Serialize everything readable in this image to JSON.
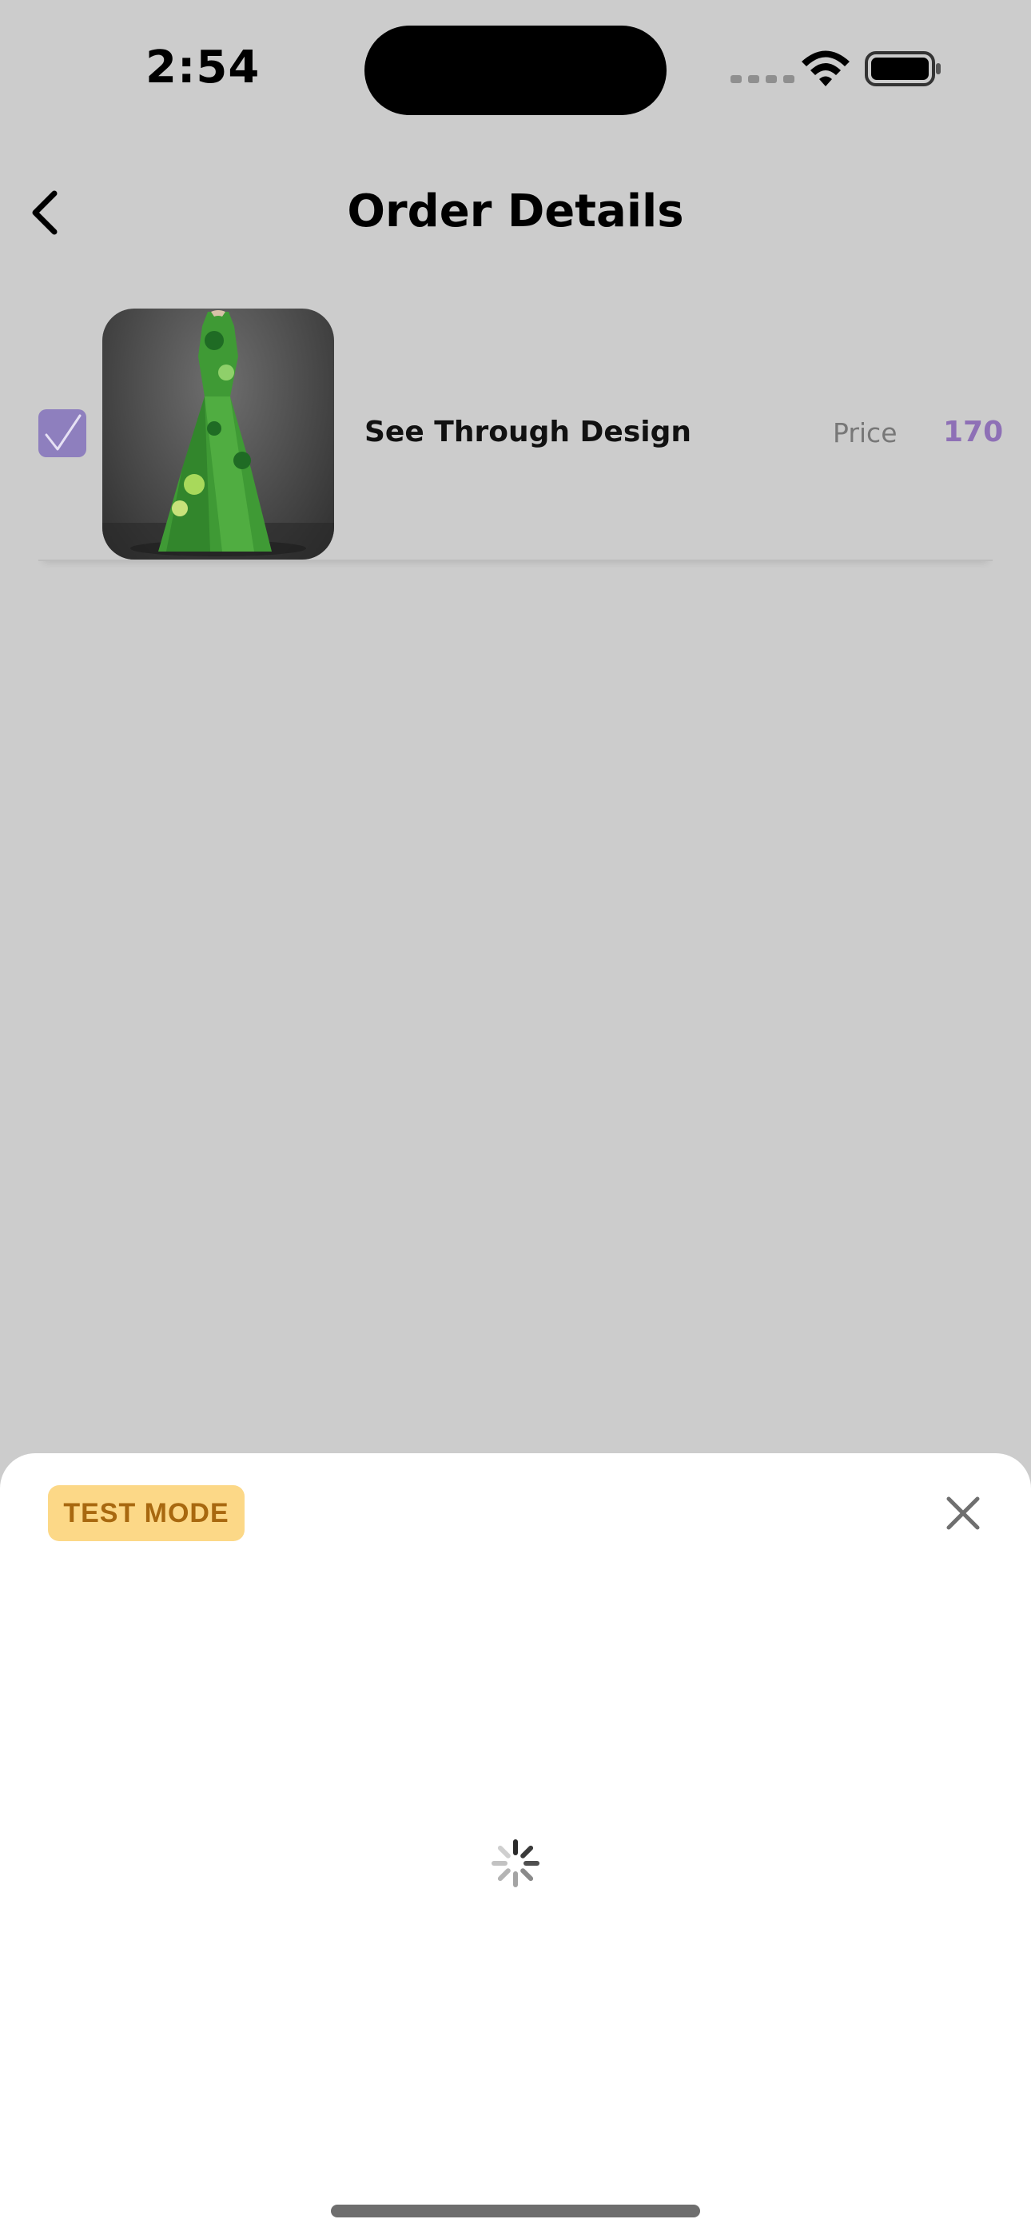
{
  "status_bar": {
    "time": "2:54"
  },
  "header": {
    "title": "Order Details",
    "back_icon": "chevron-left-icon"
  },
  "order": {
    "items": [
      {
        "selected": true,
        "name": "See Through Design",
        "price_label": "Price",
        "price": "170",
        "image": "green-gown-photo"
      }
    ]
  },
  "payment_sheet": {
    "badge": "TEST MODE",
    "close_icon": "close-icon",
    "state_icon": "loading-spinner-icon"
  },
  "colors": {
    "accent": "#8e70b6",
    "checkbox": "#8e7fbe",
    "background": "#cccccc",
    "badge_bg": "#fcd887",
    "badge_text": "#a8680f"
  }
}
